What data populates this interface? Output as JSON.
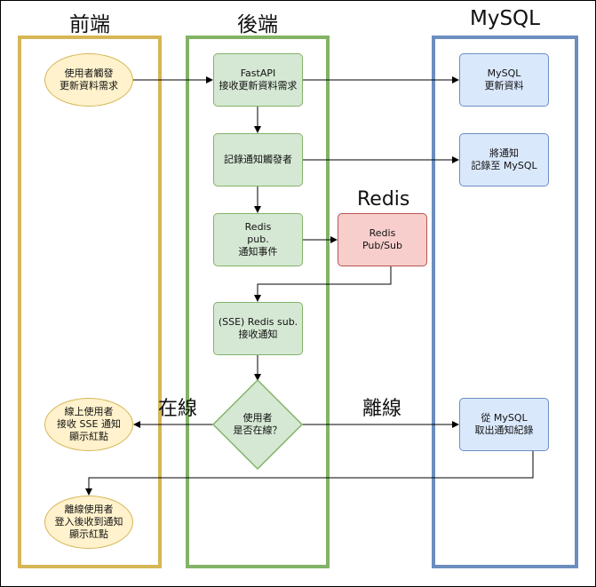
{
  "lanes": {
    "frontend": "前端",
    "backend": "後端",
    "mysql": "MySQL"
  },
  "nodes": {
    "user_trigger": "使用者觸發\n更新資料需求",
    "fastapi_receive": "FastAPI\n接收更新資料需求",
    "record_trigger": "記錄通知觸發者",
    "redis_pub": "Redis\npub.\n通知事件",
    "sse_redis_sub": "(SSE) Redis sub.\n接收通知",
    "is_online": "使用者\n是否在線？",
    "online_user": "線上使用者\n接收 SSE 通知\n顯示紅點",
    "offline_user": "離線使用者\n登入後收到通知\n顯示紅點",
    "mysql_update": "MySQL\n更新資料",
    "mysql_record": "將通知\n記錄至 MySQL",
    "mysql_fetch": "從 MySQL\n取出通知紀錄",
    "redis_pubsub": "Redis\nPub/Sub"
  },
  "labels": {
    "redis": "Redis",
    "online": "在線",
    "offline": "離線"
  },
  "colors": {
    "lane_frontend": "#d6b656",
    "lane_backend": "#82b366",
    "lane_mysql": "#6c8ebf"
  }
}
